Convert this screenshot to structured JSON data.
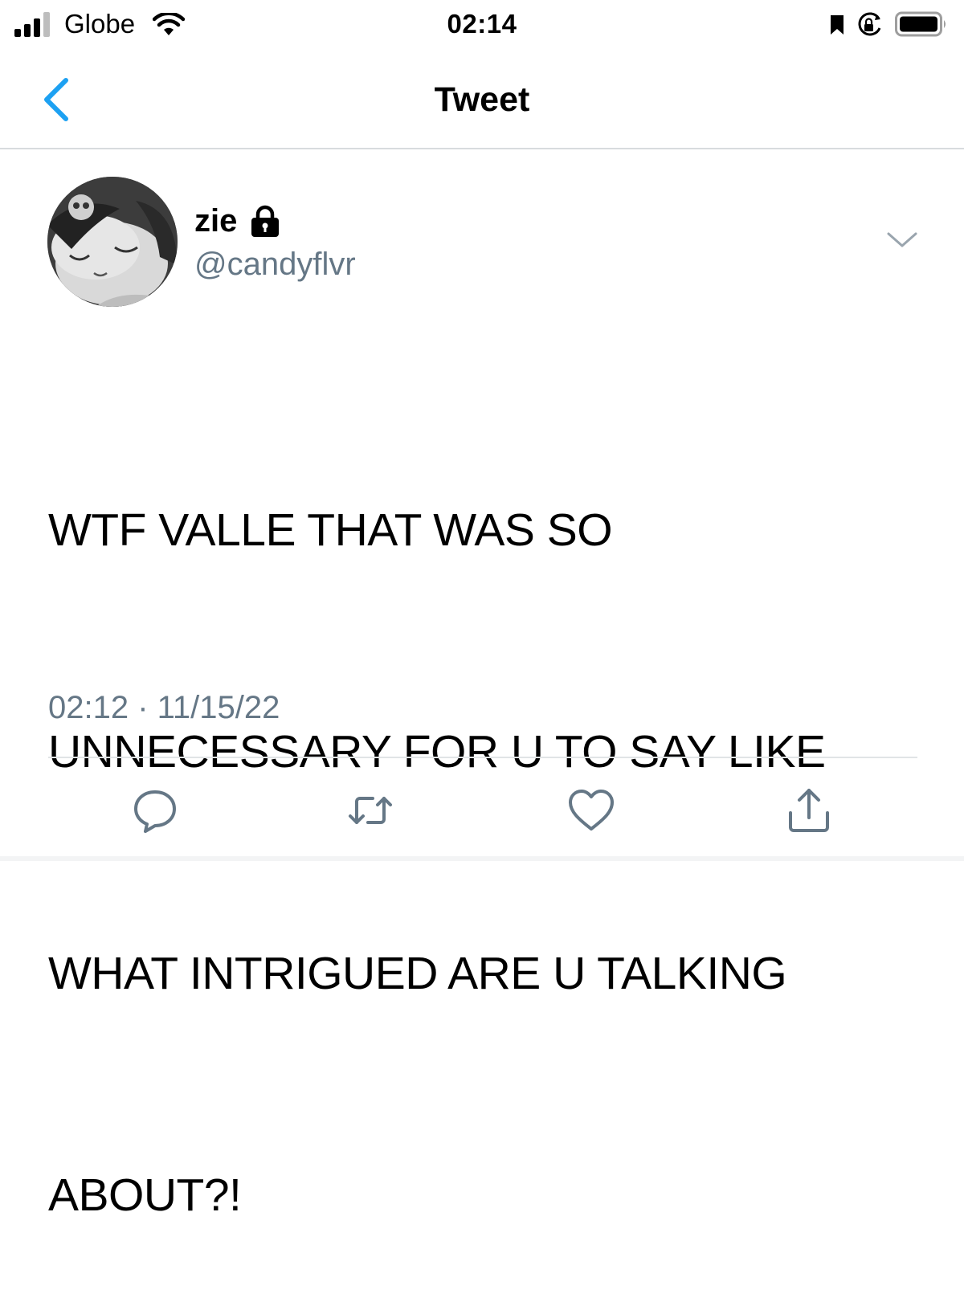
{
  "status_bar": {
    "carrier": "Globe",
    "time": "02:14",
    "icons": [
      "signal-icon",
      "wifi-icon",
      "bookmark-icon",
      "rotation-lock-icon",
      "battery-icon"
    ]
  },
  "nav": {
    "title": "Tweet",
    "back_icon": "chevron-left-icon"
  },
  "tweet": {
    "display_name": "zie",
    "protected_icon": "lock-icon",
    "handle": "@candyflvr",
    "lines": [
      "WTF VALLE THAT WAS SO",
      "UNNECESSARY FOR U TO SAY LIKE",
      "WHAT INTRIGUED ARE U TALKING",
      "ABOUT?!"
    ],
    "timestamp": "02:12 · 11/15/22",
    "menu_icon": "chevron-down-icon"
  },
  "actions": [
    {
      "name": "reply",
      "icon": "reply-icon"
    },
    {
      "name": "retweet",
      "icon": "retweet-icon"
    },
    {
      "name": "like",
      "icon": "heart-icon"
    },
    {
      "name": "share",
      "icon": "share-icon"
    }
  ],
  "colors": {
    "accent": "#1da1f2",
    "secondary_text": "#657786",
    "icon_gray": "#657786",
    "divider": "#e1e4e6"
  }
}
